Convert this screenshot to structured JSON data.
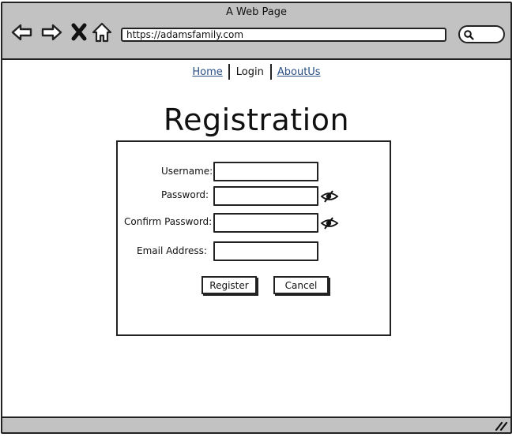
{
  "window": {
    "title": "A Web Page"
  },
  "browser": {
    "address": "https://adamsfamily.com",
    "icons": [
      "back-arrow-icon",
      "forward-arrow-icon",
      "close-x-icon",
      "home-icon",
      "search-icon"
    ]
  },
  "nav": {
    "home": "Home",
    "login": "Login",
    "about": "AboutUs"
  },
  "page": {
    "title": "Registration"
  },
  "form": {
    "username_label": "Username:",
    "password_label": "Password:",
    "confirm_label": "Confirm Password:",
    "email_label": "Email Address:",
    "username_value": "",
    "password_value": "",
    "confirm_value": "",
    "email_value": "",
    "register_label": "Register",
    "cancel_label": "Cancel",
    "eye_icon": "eye-slash-icon"
  }
}
